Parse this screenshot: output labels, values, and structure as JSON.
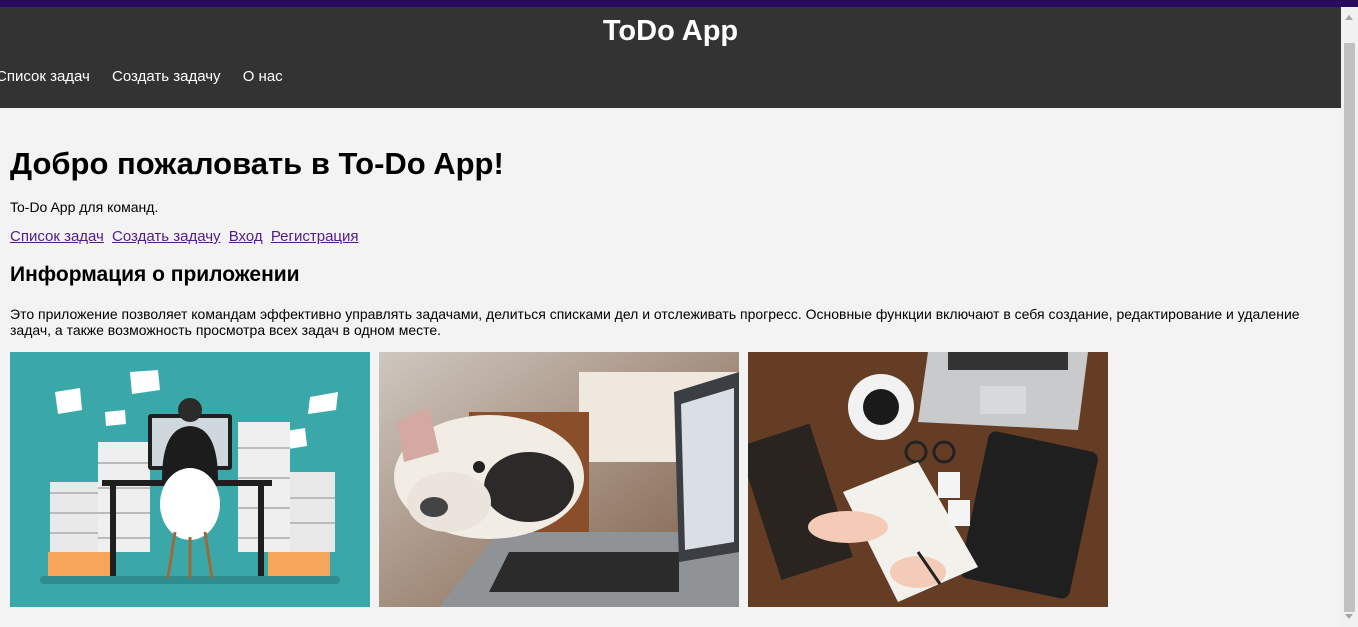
{
  "header": {
    "title": "ToDo App",
    "nav": [
      "Список задач",
      "Создать задачу",
      "О нас"
    ]
  },
  "main": {
    "heading": "Добро пожаловать в To-Do App!",
    "intro": "To-Do App для команд.",
    "links": [
      "Список задач",
      "Создать задачу",
      "Вход",
      "Регистрация"
    ],
    "info_heading": "Информация о приложении",
    "info_text": "Это приложение позволяет командам эффективно управлять задачами, делиться списками дел и отслеживать прогресс. Основные функции включают в себя создание, редактирование и удаление задач, а также возможность просмотра всех задач в одном месте.",
    "images": [
      "office-worker-paper-stacks-illustration",
      "bulldog-on-laptop-photo",
      "desk-notebook-coffee-tablet-photo"
    ]
  },
  "colors": {
    "topbar": "#2a0a5e",
    "header_bg": "#333333",
    "page_bg": "#f3f3f3",
    "visited_link": "#551a8b"
  }
}
